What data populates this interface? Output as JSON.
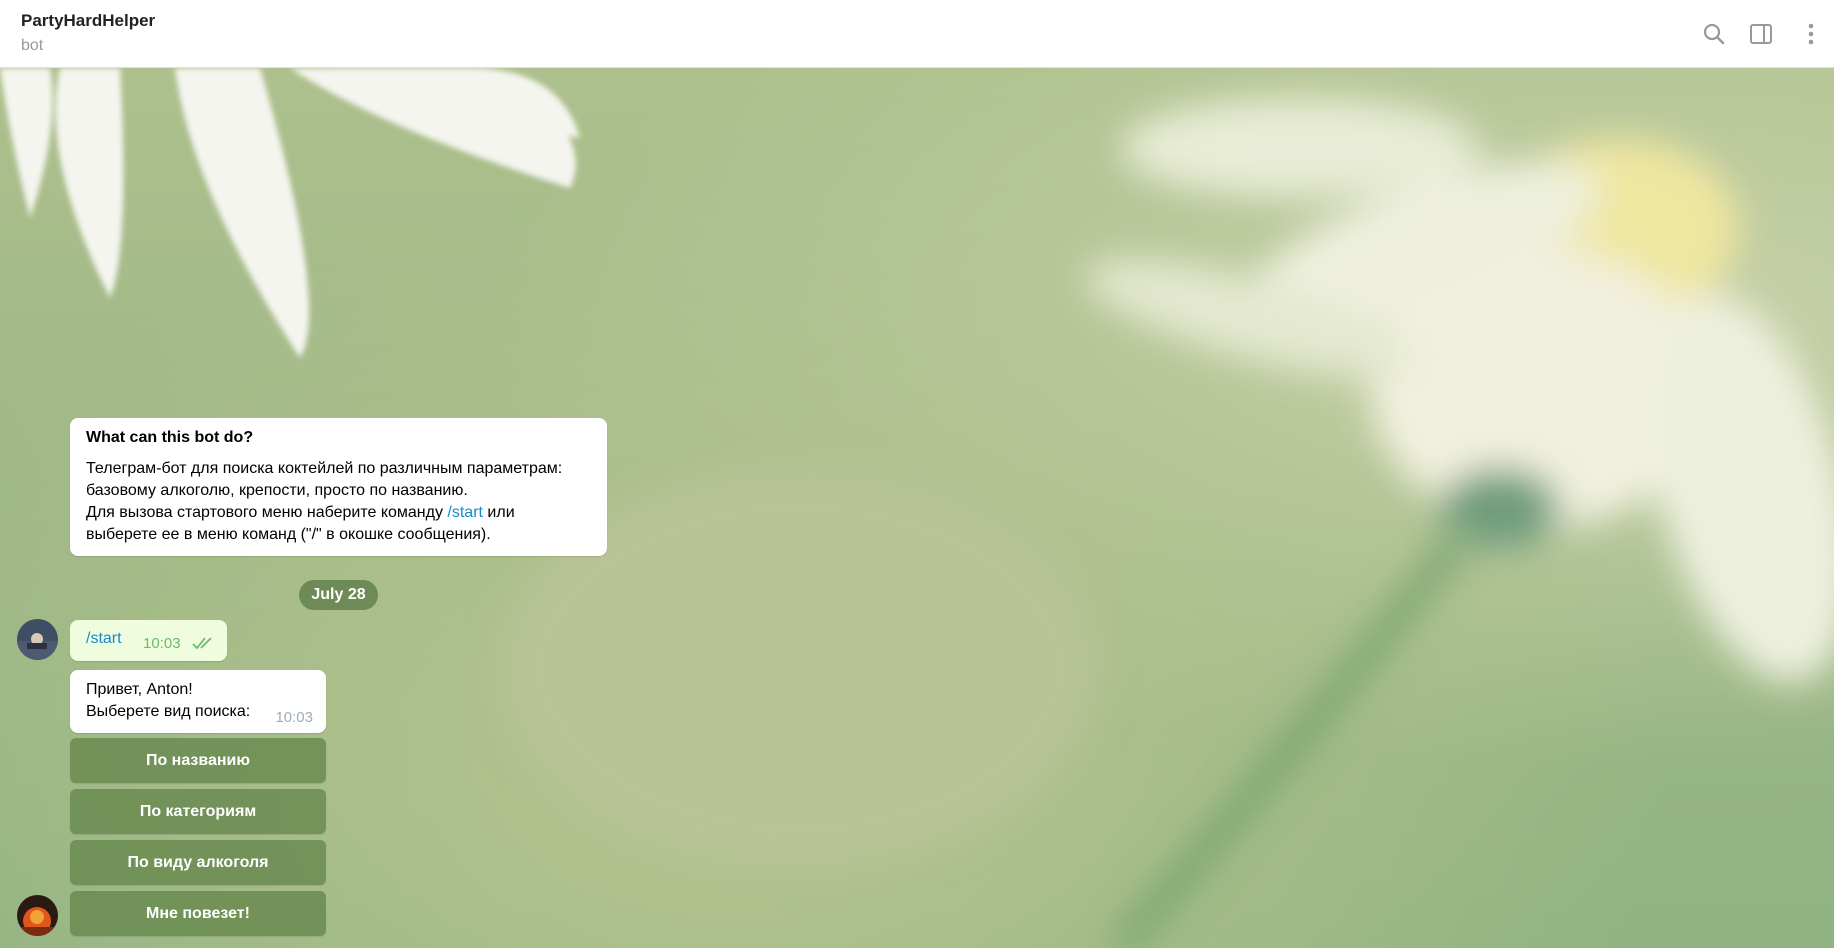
{
  "header": {
    "title": "PartyHardHelper",
    "subtitle": "bot",
    "icons": [
      "search-icon",
      "sidebar-toggle-icon",
      "more-vertical-icon"
    ]
  },
  "intro": {
    "title": "What can this bot do?",
    "line1": "Телеграм-бот для поиска коктейлей по различным параметрам:",
    "line2": "базовому алкоголю, крепости, просто по названию.",
    "line3_before": "Для вызова стартового меню наберите команду ",
    "line3_link": "/start",
    "line3_after": " или",
    "line4": "выберете ее в меню команд (\"/\" в окошке сообщения)."
  },
  "date_separator": "July 28",
  "outgoing": {
    "text": "/start",
    "time": "10:03"
  },
  "incoming": {
    "line1": "Привет, Anton!",
    "line2": "Выберете вид поиска:",
    "time": "10:03"
  },
  "keyboard": [
    "По названию",
    "По категориям",
    "По виду алкоголя",
    "Мне повезет!"
  ],
  "colors": {
    "accent": "#168acd",
    "outgoing_bg": "#effdde",
    "keyboard_btn": "#5f8246"
  }
}
